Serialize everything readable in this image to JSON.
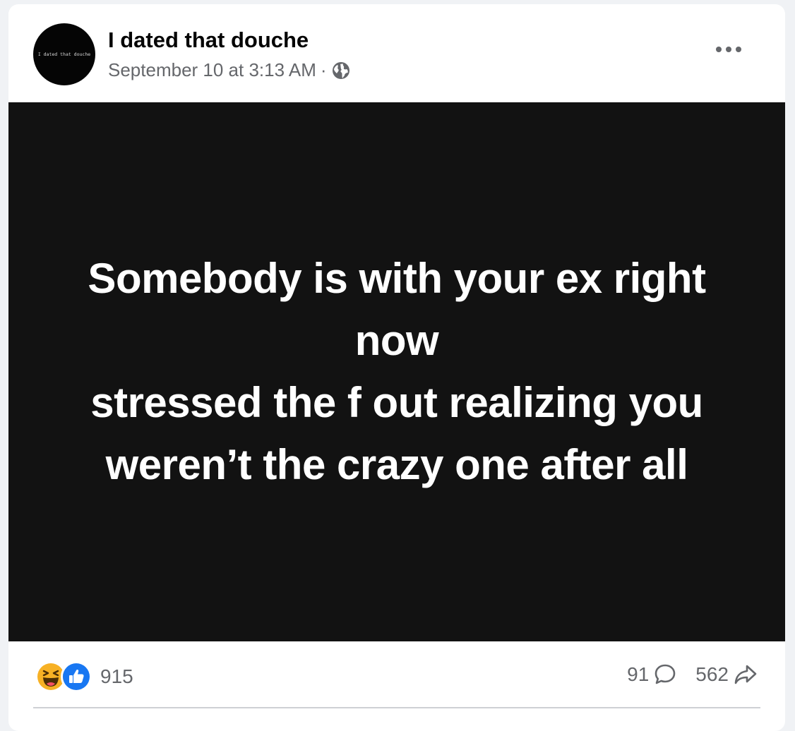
{
  "post": {
    "page_name": "I dated that douche",
    "avatar_text": "I dated that douche",
    "timestamp": "September 10 at 3:13 AM",
    "separator": "·",
    "audience_icon": "globe-icon",
    "menu_icon": "more-options-icon",
    "body_lines": [
      "Somebody is with your ex right",
      "now",
      "stressed the f out realizing you",
      "weren’t the crazy one after all"
    ],
    "image_background": "#121212",
    "text_color": "#ffffff"
  },
  "engagement": {
    "reaction_icons": [
      "haha-reaction-icon",
      "like-reaction-icon"
    ],
    "reaction_count": "915",
    "comment_count": "91",
    "comment_icon": "comment-bubble-icon",
    "share_count": "562",
    "share_icon": "share-arrow-icon"
  },
  "colors": {
    "secondary_text": "#65676b",
    "like_blue": "#1877f2",
    "haha_yellow": "#f7b125"
  }
}
